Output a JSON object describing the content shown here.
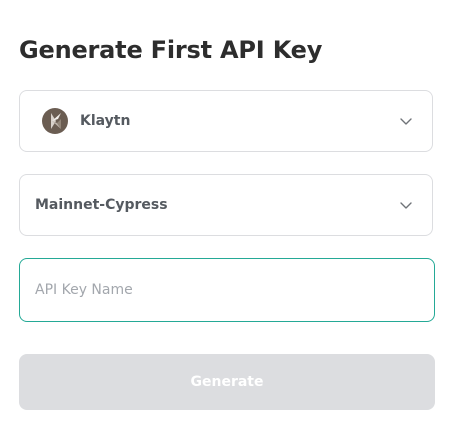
{
  "title": "Generate First API Key",
  "network_select": {
    "value": "Klaytn",
    "icon": "klaytn-logo-icon"
  },
  "chain_select": {
    "value": "Mainnet-Cypress"
  },
  "api_key_name": {
    "placeholder": "API Key Name",
    "value": ""
  },
  "generate_button": {
    "label": "Generate",
    "disabled": true
  },
  "colors": {
    "accent_border": "#24a996",
    "disabled_button": "#dcdde0",
    "border": "#dcdde0"
  }
}
